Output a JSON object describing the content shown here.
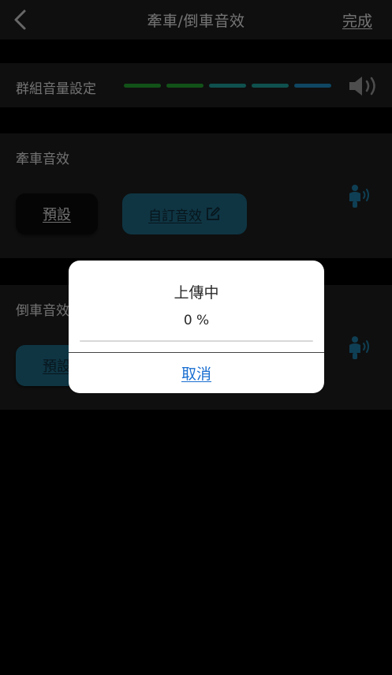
{
  "navbar": {
    "title": "牽車/倒車音效",
    "done_label": "完成",
    "back_icon": "chevron-left-icon"
  },
  "volume": {
    "label": "群組音量設定",
    "level_bars": 5,
    "bar_colors": [
      "#24a531",
      "#24a531",
      "#1fa29c",
      "#1fa29c",
      "#1e8cc2"
    ],
    "icon": "speaker-icon"
  },
  "tow_sound": {
    "title": "牽車音效",
    "default_label": "預設",
    "custom_label": "自訂音效",
    "edit_icon": "edit-icon",
    "scooter_icon": "scooter-sound-icon"
  },
  "reverse_sound": {
    "title": "倒車音效",
    "default_label": "預設",
    "scooter_icon": "scooter-sound-icon"
  },
  "dialog": {
    "title": "上傳中",
    "progress_text": "0 %",
    "progress": 0,
    "cancel_label": "取消"
  },
  "colors": {
    "accent": "#1e6b86",
    "link": "#1a6fd1",
    "panel": "#1f1f1f"
  }
}
